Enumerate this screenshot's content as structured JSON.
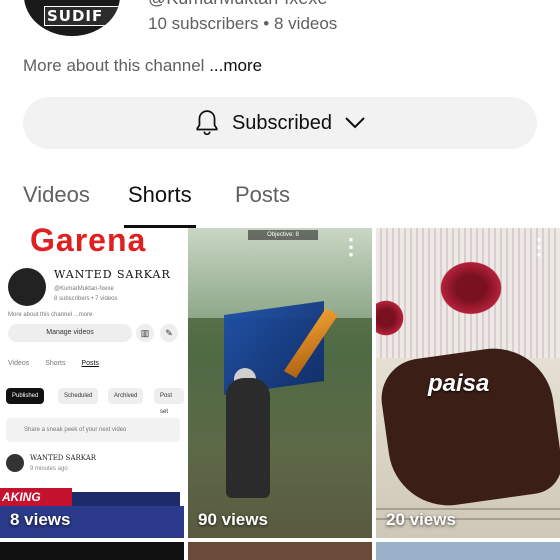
{
  "channel": {
    "handle": "@KumarMuktan-fxexe",
    "subscribers": "10 subscribers",
    "separator": "•",
    "videos": "8 videos",
    "avatar_badge": "SUDIF",
    "about": "More about this channel",
    "about_more": "...more"
  },
  "subscribe_button": {
    "label": "Subscribed"
  },
  "tabs": [
    {
      "label": "Videos"
    },
    {
      "label": "Shorts"
    },
    {
      "label": "Posts"
    }
  ],
  "shorts": [
    {
      "views": "8 views",
      "mini": {
        "brand": "Garena",
        "name": "WANTED SARKAR",
        "handle": "@KumarMuktan-fxexe",
        "meta": "8 subscribers • 7 videos",
        "about": "More about this channel ...more",
        "manage": "Manage videos",
        "tabs": [
          "Videos",
          "Shorts",
          "Posts"
        ],
        "chips": [
          "Published",
          "Scheduled",
          "Archived",
          "Post set"
        ],
        "sneak": "Share a sneak peek of your next video",
        "post_name": "WANTED SARKAR",
        "post_time": "9 minutes ago",
        "news": "AKING NEWS"
      }
    },
    {
      "views": "90 views",
      "hud": "Objective: 8"
    },
    {
      "views": "20 views",
      "caption": "paisa"
    }
  ],
  "colors": {
    "text_primary": "#0f0f0f",
    "text_secondary": "#606060",
    "button_bg": "#f2f2f2"
  }
}
